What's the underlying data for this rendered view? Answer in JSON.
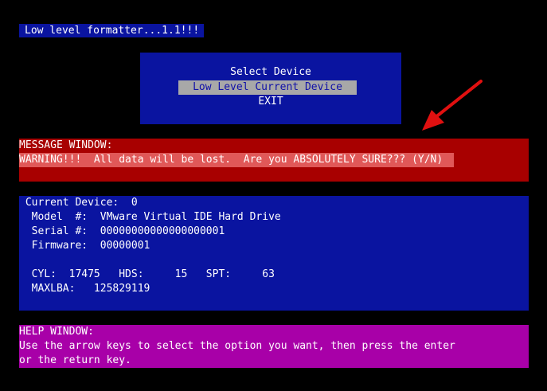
{
  "title": "Low level formatter...1.1!!!",
  "menu": {
    "items": [
      {
        "label": "Select Device"
      },
      {
        "label": "Low Level Current Device"
      },
      {
        "label": "EXIT"
      }
    ]
  },
  "message_window": {
    "header": "MESSAGE WINDOW:",
    "text": "WARNING!!!  All data will be lost.  Are you ABSOLUTELY SURE??? (Y/N)"
  },
  "device": {
    "current": " Current Device:  0",
    "model": "  Model  #:  VMware Virtual IDE Hard Drive",
    "serial": "  Serial #:  00000000000000000001",
    "firmware": "  Firmware:  00000001",
    "geometry": "  CYL:  17475   HDS:     15   SPT:     63",
    "maxlba": "  MAXLBA:   125829119"
  },
  "help_window": {
    "header": "HELP WINDOW:",
    "line1": "Use the arrow keys to select the option you want, then press the enter",
    "line2": "or the return key."
  },
  "colors": {
    "panel_blue": "#0a14a0",
    "message_red": "#a80000",
    "warning_highlight": "#e05858",
    "help_magenta": "#a800a8",
    "selection_gray": "#a8a8a8",
    "arrow_red": "#e01010"
  }
}
